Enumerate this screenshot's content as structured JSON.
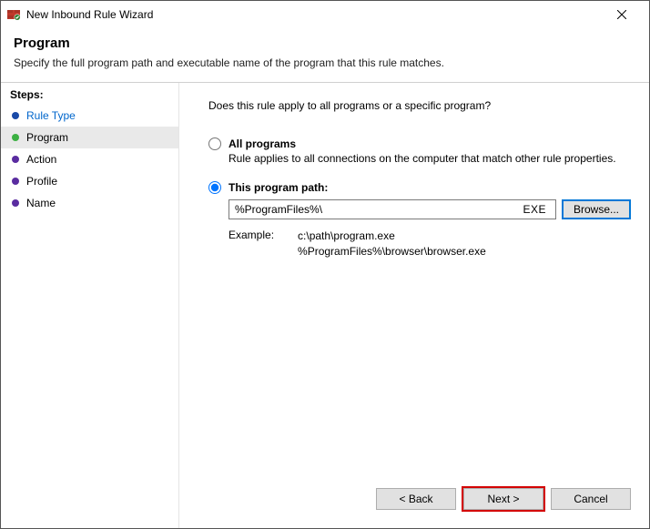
{
  "window": {
    "title": "New Inbound Rule Wizard"
  },
  "header": {
    "title": "Program",
    "description": "Specify the full program path and executable name of the program that this rule matches."
  },
  "sidebar": {
    "heading": "Steps:",
    "items": [
      {
        "label": "Rule Type"
      },
      {
        "label": "Program"
      },
      {
        "label": "Action"
      },
      {
        "label": "Profile"
      },
      {
        "label": "Name"
      }
    ]
  },
  "content": {
    "question": "Does this rule apply to all programs or a specific program?",
    "all_programs": {
      "label": "All programs",
      "description": "Rule applies to all connections on the computer that match other rule properties."
    },
    "this_program": {
      "label": "This program path:",
      "value": "%ProgramFiles%\\",
      "ext": "EXE",
      "browse": "Browse...",
      "example_label": "Example:",
      "example_line1": "c:\\path\\program.exe",
      "example_line2": "%ProgramFiles%\\browser\\browser.exe"
    }
  },
  "footer": {
    "back": "< Back",
    "next": "Next >",
    "cancel": "Cancel"
  }
}
